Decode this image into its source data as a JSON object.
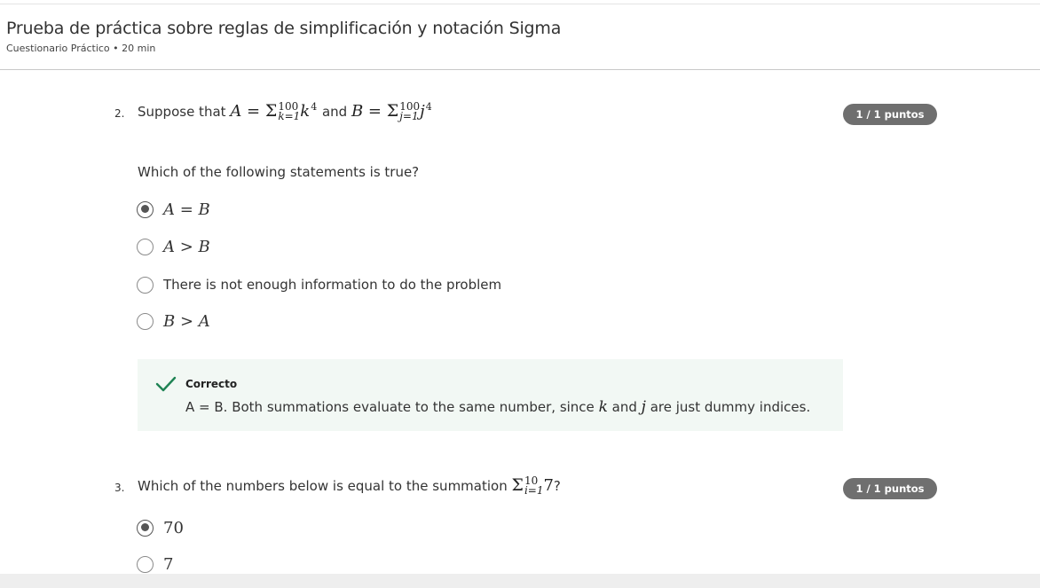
{
  "header": {
    "title": "Prueba de práctica sobre reglas de simplificación y notación Sigma",
    "subtitle": "Cuestionario Práctico • 20 min"
  },
  "q2": {
    "number": "2.",
    "intro": "Suppose that",
    "A_var": "A",
    "eq": "=",
    "sigma": "Σ",
    "A_upper": "100",
    "A_lower": "k=1",
    "A_term": "k",
    "A_exp": "4",
    "and": "and",
    "B_var": "B",
    "B_upper": "100",
    "B_lower": "j=1",
    "B_term": "j",
    "B_exp": "4",
    "badge": "1 / 1 puntos",
    "prompt": "Which of the following statements is true?",
    "options": [
      {
        "label": "A = B",
        "selected": true
      },
      {
        "label": "A > B",
        "selected": false
      },
      {
        "label": "There is not enough information to do the problem",
        "selected": false
      },
      {
        "label": "B > A",
        "selected": false
      }
    ],
    "feedback": {
      "title": "Correcto",
      "text_a": "A = B. Both summations evaluate to the same number, since",
      "var_k": "k",
      "text_b": "and",
      "var_j": "j",
      "text_c": "are just dummy indices."
    }
  },
  "q3": {
    "number": "3.",
    "intro": "Which of the numbers below is equal to the summation",
    "sigma": "Σ",
    "upper": "10",
    "lower": "i=1",
    "term": "7",
    "end": "?",
    "badge": "1 / 1 puntos",
    "options": [
      {
        "label": "70",
        "selected": true
      },
      {
        "label": "7",
        "selected": false
      }
    ]
  },
  "colors": {
    "badge_bg": "#6f6f6f",
    "feedback_bg": "#f2f8f4",
    "check": "#1f8354"
  }
}
